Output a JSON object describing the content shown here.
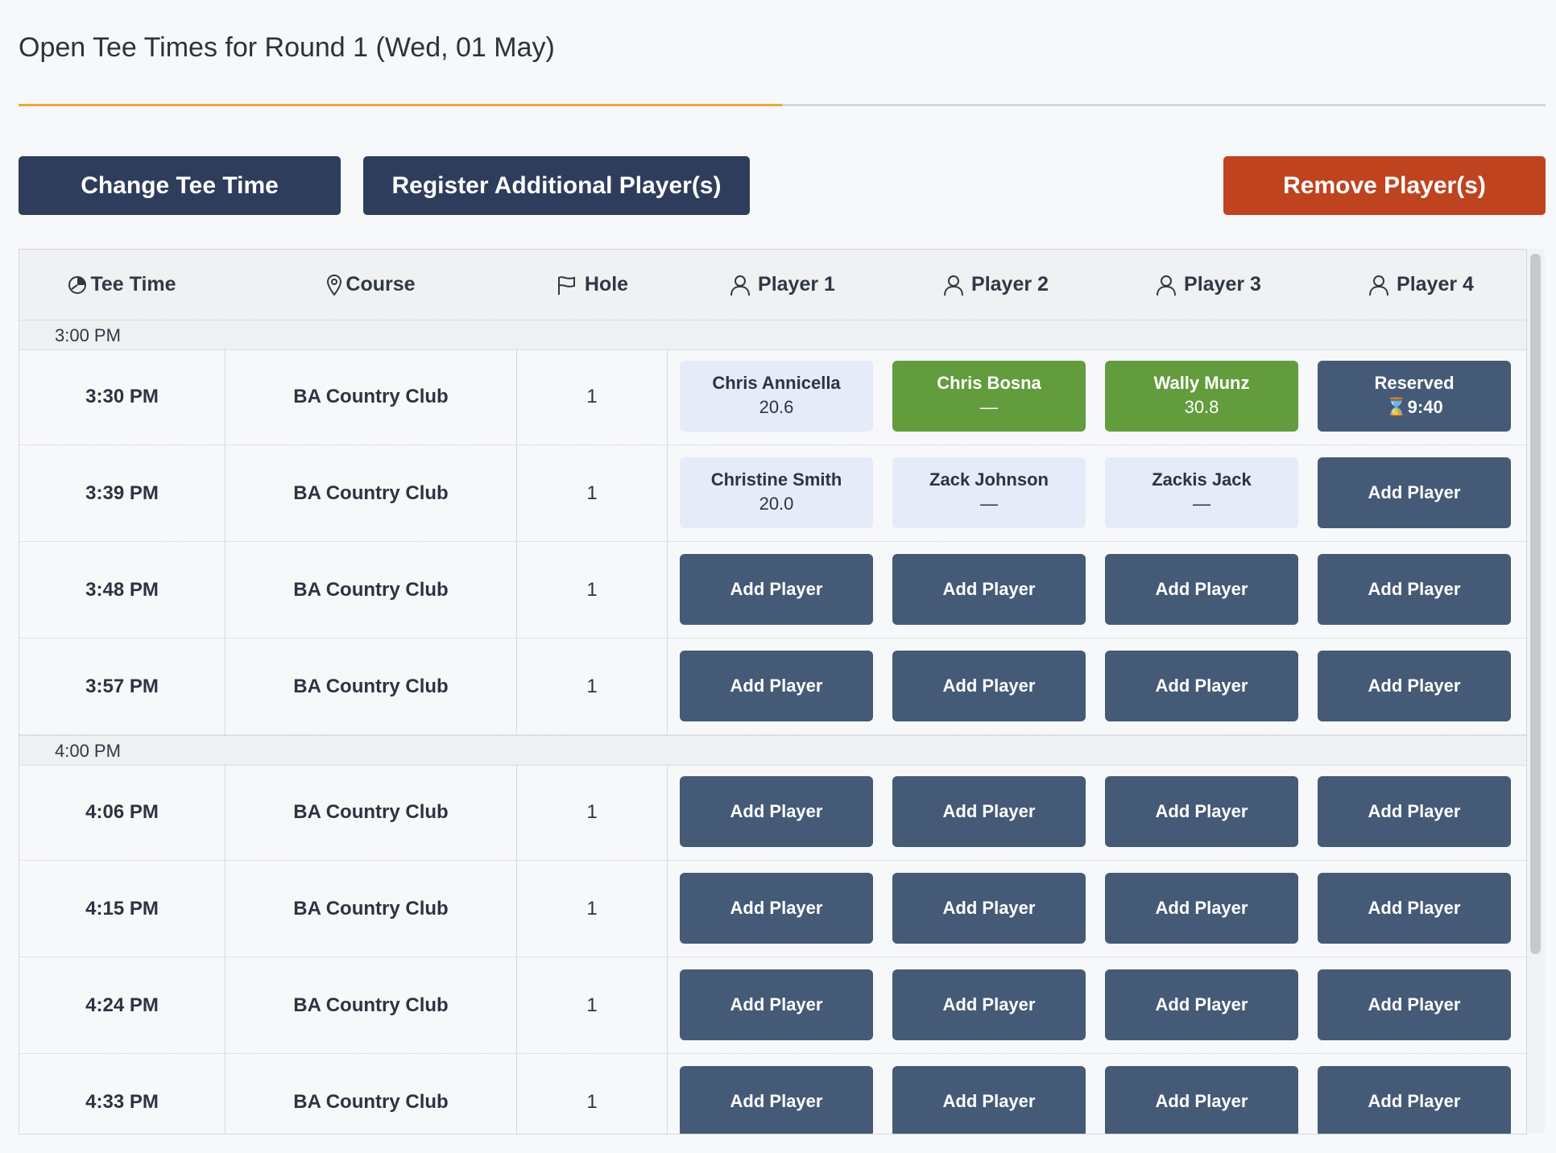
{
  "page": {
    "title": "Open Tee Times for Round 1 (Wed, 01 May)"
  },
  "actions": {
    "change_tee_time": "Change Tee Time",
    "register_additional": "Register Additional Player(s)",
    "remove_players": "Remove Player(s)"
  },
  "table": {
    "headers": {
      "tee_time": "Tee Time",
      "course": "Course",
      "hole": "Hole",
      "player1": "Player 1",
      "player2": "Player 2",
      "player3": "Player 3",
      "player4": "Player 4"
    },
    "groups": [
      {
        "label": "3:00 PM",
        "rows": [
          {
            "time": "3:30 PM",
            "course": "BA Country Club",
            "hole": "1",
            "players": [
              {
                "type": "light",
                "name": "Chris Annicella",
                "value": "20.6"
              },
              {
                "type": "green",
                "name": "Chris Bosna",
                "value": "—"
              },
              {
                "type": "green",
                "name": "Wally Munz",
                "value": "30.8"
              },
              {
                "type": "reserved",
                "name": "Reserved",
                "value": "⌛9:40"
              }
            ]
          },
          {
            "time": "3:39 PM",
            "course": "BA Country Club",
            "hole": "1",
            "players": [
              {
                "type": "light",
                "name": "Christine Smith",
                "value": "20.0"
              },
              {
                "type": "light",
                "name": "Zack Johnson",
                "value": "—"
              },
              {
                "type": "light",
                "name": "Zackis Jack",
                "value": "—"
              },
              {
                "type": "add",
                "name": "Add Player"
              }
            ]
          },
          {
            "time": "3:48 PM",
            "course": "BA Country Club",
            "hole": "1",
            "players": [
              {
                "type": "add",
                "name": "Add Player"
              },
              {
                "type": "add",
                "name": "Add Player"
              },
              {
                "type": "add",
                "name": "Add Player"
              },
              {
                "type": "add",
                "name": "Add Player"
              }
            ]
          },
          {
            "time": "3:57 PM",
            "course": "BA Country Club",
            "hole": "1",
            "players": [
              {
                "type": "add",
                "name": "Add Player"
              },
              {
                "type": "add",
                "name": "Add Player"
              },
              {
                "type": "add",
                "name": "Add Player"
              },
              {
                "type": "add",
                "name": "Add Player"
              }
            ]
          }
        ]
      },
      {
        "label": "4:00 PM",
        "rows": [
          {
            "time": "4:06 PM",
            "course": "BA Country Club",
            "hole": "1",
            "players": [
              {
                "type": "add",
                "name": "Add Player"
              },
              {
                "type": "add",
                "name": "Add Player"
              },
              {
                "type": "add",
                "name": "Add Player"
              },
              {
                "type": "add",
                "name": "Add Player"
              }
            ]
          },
          {
            "time": "4:15 PM",
            "course": "BA Country Club",
            "hole": "1",
            "players": [
              {
                "type": "add",
                "name": "Add Player"
              },
              {
                "type": "add",
                "name": "Add Player"
              },
              {
                "type": "add",
                "name": "Add Player"
              },
              {
                "type": "add",
                "name": "Add Player"
              }
            ]
          },
          {
            "time": "4:24 PM",
            "course": "BA Country Club",
            "hole": "1",
            "players": [
              {
                "type": "add",
                "name": "Add Player"
              },
              {
                "type": "add",
                "name": "Add Player"
              },
              {
                "type": "add",
                "name": "Add Player"
              },
              {
                "type": "add",
                "name": "Add Player"
              }
            ]
          },
          {
            "time": "4:33 PM",
            "course": "BA Country Club",
            "hole": "1",
            "players": [
              {
                "type": "add",
                "name": "Add Player"
              },
              {
                "type": "add",
                "name": "Add Player"
              },
              {
                "type": "add",
                "name": "Add Player"
              },
              {
                "type": "add",
                "name": "Add Player"
              }
            ]
          }
        ]
      }
    ]
  }
}
